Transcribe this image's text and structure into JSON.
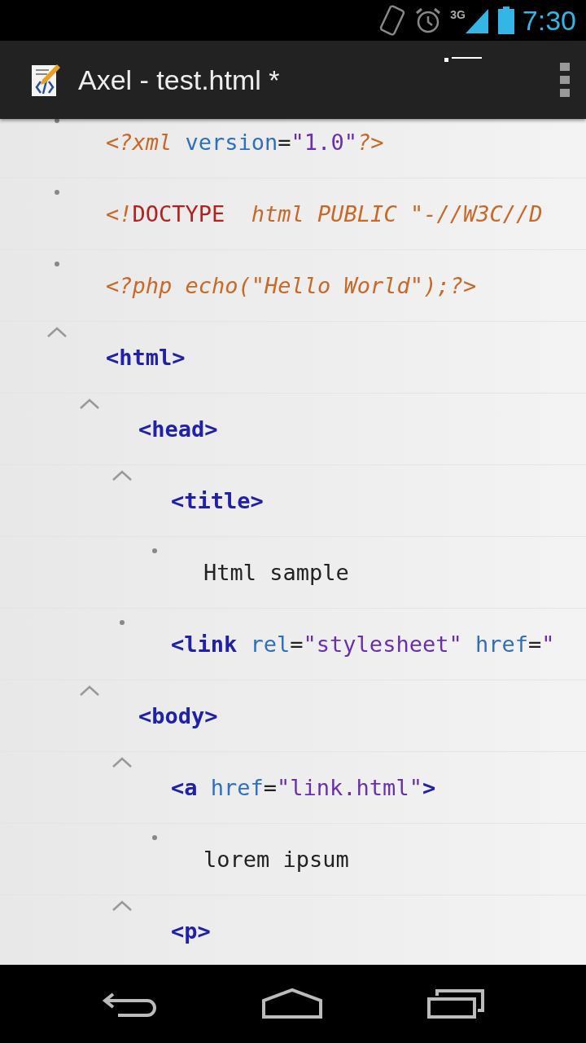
{
  "status_bar": {
    "network": "3G",
    "time": "7:30"
  },
  "action_bar": {
    "title": "Axel - test.html *"
  },
  "tree": [
    {
      "tokens": [
        {
          "kind": "pi",
          "text": "<?xml "
        },
        {
          "kind": "attr",
          "text": "version"
        },
        {
          "kind": "eq",
          "text": "="
        },
        {
          "kind": "value",
          "text": "\"1.0\""
        },
        {
          "kind": "pi",
          "text": "?>"
        }
      ]
    },
    {
      "tokens": [
        {
          "kind": "pi",
          "text": "<!"
        },
        {
          "kind": "doctype",
          "text": "DOCTYPE"
        },
        {
          "kind": "pi",
          "text": "  html PUBLIC \"-//W3C//D"
        }
      ]
    },
    {
      "tokens": [
        {
          "kind": "pi",
          "text": "<?php echo(\"Hello World\");?>"
        }
      ]
    },
    {
      "expanded": true,
      "tokens": [
        {
          "kind": "tag",
          "text": "<html>"
        }
      ],
      "children": [
        {
          "expanded": true,
          "tokens": [
            {
              "kind": "tag",
              "text": "<head>"
            }
          ],
          "children": [
            {
              "expanded": true,
              "tokens": [
                {
                  "kind": "tag",
                  "text": "<title>"
                }
              ],
              "children": [
                {
                  "tokens": [
                    {
                      "kind": "text",
                      "text": "Html sample"
                    }
                  ]
                }
              ]
            },
            {
              "tokens": [
                {
                  "kind": "tag",
                  "text": "<link "
                },
                {
                  "kind": "attr",
                  "text": "rel"
                },
                {
                  "kind": "eq",
                  "text": "="
                },
                {
                  "kind": "value",
                  "text": "\"stylesheet\" "
                },
                {
                  "kind": "attr",
                  "text": "href"
                },
                {
                  "kind": "eq",
                  "text": "="
                },
                {
                  "kind": "value",
                  "text": "\""
                }
              ]
            }
          ]
        },
        {
          "expanded": true,
          "tokens": [
            {
              "kind": "tag",
              "text": "<body>"
            }
          ],
          "children": [
            {
              "expanded": true,
              "tokens": [
                {
                  "kind": "tag",
                  "text": "<a "
                },
                {
                  "kind": "attr",
                  "text": "href"
                },
                {
                  "kind": "eq",
                  "text": "="
                },
                {
                  "kind": "value",
                  "text": "\"link.html\""
                },
                {
                  "kind": "tag",
                  "text": ">"
                }
              ],
              "children": [
                {
                  "tokens": [
                    {
                      "kind": "text",
                      "text": "lorem ipsum"
                    }
                  ]
                }
              ]
            },
            {
              "expanded": true,
              "tokens": [
                {
                  "kind": "tag",
                  "text": "<p>"
                }
              ]
            }
          ]
        }
      ]
    }
  ]
}
